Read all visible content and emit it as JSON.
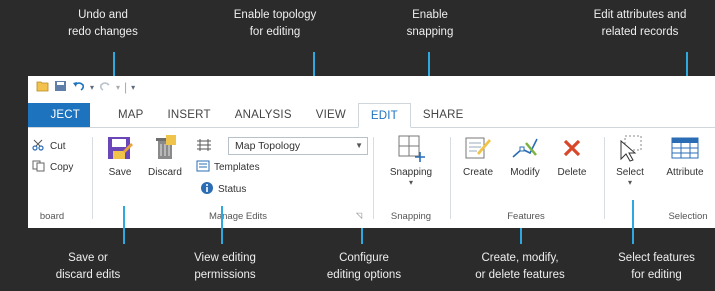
{
  "callouts": {
    "undo": "Undo and\nredo changes",
    "topology": "Enable topology\nfor editing",
    "snapping": "Enable\nsnapping",
    "attributes": "Edit attributes and\nrelated records",
    "save": "Save or\ndiscard edits",
    "status": "View editing\npermissions",
    "configure": "Configure\nediting options",
    "features": "Create, modify,\nor delete features",
    "select": "Select features\nfor editing"
  },
  "tabs": [
    {
      "label": "JECT"
    },
    {
      "label": "MAP"
    },
    {
      "label": "INSERT"
    },
    {
      "label": "ANALYSIS"
    },
    {
      "label": "VIEW"
    },
    {
      "label": "EDIT"
    },
    {
      "label": "SHARE"
    }
  ],
  "clipboard": {
    "cut": "Cut",
    "copy": "Copy",
    "group_label": "board"
  },
  "manage_edits": {
    "save": "Save",
    "discard": "Discard",
    "topology_value": "Map Topology",
    "templates": "Templates",
    "status": "Status",
    "group_label": "Manage Edits"
  },
  "snapping_group": {
    "snapping": "Snapping",
    "group_label": "Snapping"
  },
  "features_group": {
    "create": "Create",
    "modify": "Modify",
    "delete": "Delete",
    "group_label": "Features"
  },
  "selection_group": {
    "select": "Select",
    "attributes": "Attribute",
    "group_label": "Selection"
  },
  "colors": {
    "accent": "#1e73be",
    "leader": "#2fa8e0",
    "background": "#2b2b2b"
  }
}
